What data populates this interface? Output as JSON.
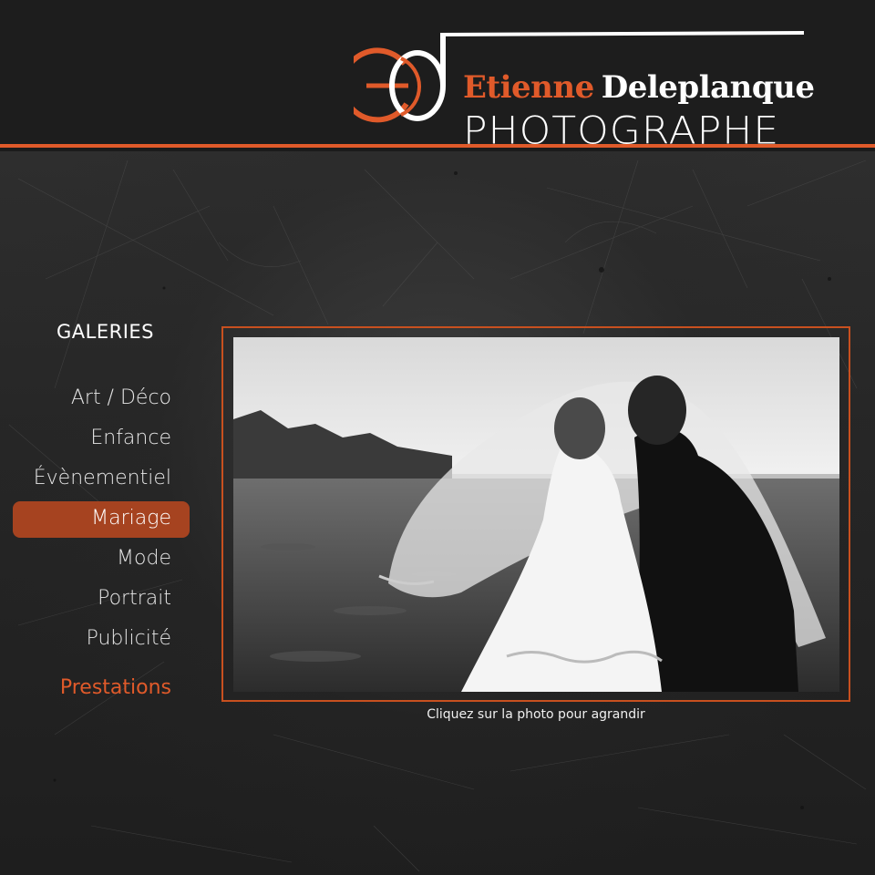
{
  "brand": {
    "first_name": "Etienne",
    "last_name": "Deleplanque",
    "subtitle": "PHOTOGRAPHE",
    "monogram_icon": "eo-monogram-icon",
    "accent_color": "#e05a2a"
  },
  "sidebar": {
    "heading": "GALERIES",
    "items": [
      {
        "label": "Art / Déco"
      },
      {
        "label": "Enfance"
      },
      {
        "label": "Évènementiel"
      },
      {
        "label": "Mariage",
        "active": true
      },
      {
        "label": "Mode"
      },
      {
        "label": "Portrait"
      },
      {
        "label": "Publicité"
      }
    ],
    "extra_link": "Prestations"
  },
  "gallery": {
    "photo_description_icon": "wedding-photo",
    "caption": "Cliquez sur la photo pour agrandir"
  }
}
